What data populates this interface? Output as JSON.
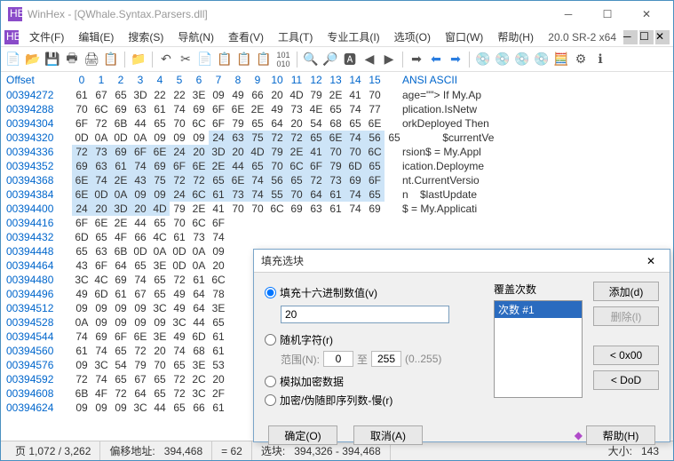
{
  "window": {
    "title": "WinHex - [QWhale.Syntax.Parsers.dll]"
  },
  "menu": {
    "items": [
      "文件(F)",
      "编辑(E)",
      "搜索(S)",
      "导航(N)",
      "查看(V)",
      "工具(T)",
      "专业工具(I)",
      "选项(O)",
      "窗口(W)",
      "帮助(H)"
    ],
    "version": "20.0 SR-2 x64"
  },
  "hex": {
    "offset_label": "Offset",
    "cols": [
      "0",
      "1",
      "2",
      "3",
      "4",
      "5",
      "6",
      "7",
      "8",
      "9",
      "10",
      "11",
      "12",
      "13",
      "14",
      "15"
    ],
    "ascii_label": "ANSI ASCII",
    "rows": [
      {
        "off": "00394272",
        "b": [
          "61",
          "67",
          "65",
          "3D",
          "22",
          "22",
          "3E",
          "09",
          "49",
          "66",
          "20",
          "4D",
          "79",
          "2E",
          "41",
          "70"
        ],
        "a": "age=\"\"> If My.Ap",
        "sel": []
      },
      {
        "off": "00394288",
        "b": [
          "70",
          "6C",
          "69",
          "63",
          "61",
          "74",
          "69",
          "6F",
          "6E",
          "2E",
          "49",
          "73",
          "4E",
          "65",
          "74",
          "77"
        ],
        "a": "plication.IsNetw",
        "sel": []
      },
      {
        "off": "00394304",
        "b": [
          "6F",
          "72",
          "6B",
          "44",
          "65",
          "70",
          "6C",
          "6F",
          "79",
          "65",
          "64",
          "20",
          "54",
          "68",
          "65",
          "6E"
        ],
        "a": "orkDeployed Then",
        "sel": []
      },
      {
        "off": "00394320",
        "b": [
          "0D",
          "0A",
          "0D",
          "0A",
          "09",
          "09",
          "09",
          "24",
          "63",
          "75",
          "72",
          "72",
          "65",
          "6E",
          "74",
          "56",
          "65"
        ],
        "a": "       $currentVe",
        "sel": [
          7,
          8,
          9,
          10,
          11,
          12,
          13,
          14,
          15
        ]
      },
      {
        "off": "00394336",
        "b": [
          "72",
          "73",
          "69",
          "6F",
          "6E",
          "24",
          "20",
          "3D",
          "20",
          "4D",
          "79",
          "2E",
          "41",
          "70",
          "70",
          "6C"
        ],
        "a": "rsion$ = My.Appl",
        "sel": [
          0,
          1,
          2,
          3,
          4,
          5,
          6,
          7,
          8,
          9,
          10,
          11,
          12,
          13,
          14,
          15
        ]
      },
      {
        "off": "00394352",
        "b": [
          "69",
          "63",
          "61",
          "74",
          "69",
          "6F",
          "6E",
          "2E",
          "44",
          "65",
          "70",
          "6C",
          "6F",
          "79",
          "6D",
          "65"
        ],
        "a": "ication.Deployme",
        "sel": [
          0,
          1,
          2,
          3,
          4,
          5,
          6,
          7,
          8,
          9,
          10,
          11,
          12,
          13,
          14,
          15
        ]
      },
      {
        "off": "00394368",
        "b": [
          "6E",
          "74",
          "2E",
          "43",
          "75",
          "72",
          "72",
          "65",
          "6E",
          "74",
          "56",
          "65",
          "72",
          "73",
          "69",
          "6F"
        ],
        "a": "nt.CurrentVersio",
        "sel": [
          0,
          1,
          2,
          3,
          4,
          5,
          6,
          7,
          8,
          9,
          10,
          11,
          12,
          13,
          14,
          15
        ]
      },
      {
        "off": "00394384",
        "b": [
          "6E",
          "0D",
          "0A",
          "09",
          "09",
          "24",
          "6C",
          "61",
          "73",
          "74",
          "55",
          "70",
          "64",
          "61",
          "74",
          "65"
        ],
        "a": "n    $lastUpdate",
        "sel": [
          0,
          1,
          2,
          3,
          4,
          5,
          6,
          7,
          8,
          9,
          10,
          11,
          12,
          13,
          14,
          15
        ]
      },
      {
        "off": "00394400",
        "b": [
          "24",
          "20",
          "3D",
          "20",
          "4D",
          "79",
          "2E",
          "41",
          "70",
          "70",
          "6C",
          "69",
          "63",
          "61",
          "74",
          "69"
        ],
        "a": "$ = My.Applicati",
        "sel": [
          0,
          1,
          2,
          3,
          4
        ]
      },
      {
        "off": "00394416",
        "b": [
          "6F",
          "6E",
          "2E",
          "44",
          "65",
          "70",
          "6C",
          "6F"
        ],
        "a": "",
        "sel": []
      },
      {
        "off": "00394432",
        "b": [
          "6D",
          "65",
          "4F",
          "66",
          "4C",
          "61",
          "73",
          "74"
        ],
        "a": "",
        "sel": []
      },
      {
        "off": "00394448",
        "b": [
          "65",
          "63",
          "6B",
          "0D",
          "0A",
          "0D",
          "0A",
          "09"
        ],
        "a": "",
        "sel": []
      },
      {
        "off": "00394464",
        "b": [
          "43",
          "6F",
          "64",
          "65",
          "3E",
          "0D",
          "0A",
          "20"
        ],
        "a": "",
        "sel": []
      },
      {
        "off": "00394480",
        "b": [
          "3C",
          "4C",
          "69",
          "74",
          "65",
          "72",
          "61",
          "6C"
        ],
        "a": "",
        "sel": []
      },
      {
        "off": "00394496",
        "b": [
          "49",
          "6D",
          "61",
          "67",
          "65",
          "49",
          "64",
          "78"
        ],
        "a": "",
        "sel": []
      },
      {
        "off": "00394512",
        "b": [
          "09",
          "09",
          "09",
          "09",
          "3C",
          "49",
          "64",
          "3E"
        ],
        "a": "",
        "sel": []
      },
      {
        "off": "00394528",
        "b": [
          "0A",
          "09",
          "09",
          "09",
          "09",
          "3C",
          "44",
          "65"
        ],
        "a": "",
        "sel": []
      },
      {
        "off": "00394544",
        "b": [
          "74",
          "69",
          "6F",
          "6E",
          "3E",
          "49",
          "6D",
          "61"
        ],
        "a": "",
        "sel": []
      },
      {
        "off": "00394560",
        "b": [
          "61",
          "74",
          "65",
          "72",
          "20",
          "74",
          "68",
          "61"
        ],
        "a": "",
        "sel": []
      },
      {
        "off": "00394576",
        "b": [
          "09",
          "3C",
          "54",
          "79",
          "70",
          "65",
          "3E",
          "53"
        ],
        "a": "",
        "sel": []
      },
      {
        "off": "00394592",
        "b": [
          "72",
          "74",
          "65",
          "67",
          "65",
          "72",
          "2C",
          "20"
        ],
        "a": "",
        "sel": []
      },
      {
        "off": "00394608",
        "b": [
          "6B",
          "4F",
          "72",
          "64",
          "65",
          "72",
          "3C",
          "2F"
        ],
        "a": "",
        "sel": []
      },
      {
        "off": "00394624",
        "b": [
          "09",
          "09",
          "09",
          "3C",
          "44",
          "65",
          "66",
          "61"
        ],
        "a": "",
        "sel": []
      }
    ]
  },
  "status": {
    "page": "页 1,072 / 3,262",
    "offlabel": "偏移地址:",
    "offset": "394,468",
    "eq": "= 62",
    "sellabel": "选块:",
    "sel": "394,326 - 394,468",
    "sizelabel": "大小:",
    "size": "143"
  },
  "dialog": {
    "title": "填充选块",
    "r1": "填充十六进制数值(v)",
    "hex": "20",
    "r2": "随机字符(r)",
    "rangelabel": "范围(N):",
    "from": "0",
    "to_label": "至",
    "to": "255",
    "hint": "(0..255)",
    "r3": "模拟加密数据",
    "r4": "加密/伪随即序列数-慢(r)",
    "grp": "覆盖次数",
    "item": "次数 #1",
    "add": "添加(d)",
    "del": "删除(l)",
    "zero": "< 0x00",
    "dod": "< DoD",
    "ok": "确定(O)",
    "cancel": "取消(A)",
    "help": "帮助(H)"
  }
}
